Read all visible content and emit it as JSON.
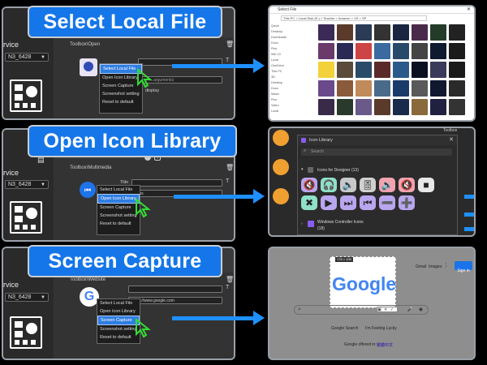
{
  "banners": [
    "Select Local File",
    "Open Icon Library",
    "Screen Capture"
  ],
  "sidebar": {
    "label": "rvice",
    "combo_value": "N3_6428"
  },
  "panel1": {
    "section": "Toolbox\\Open",
    "field_hint": "...arguments)"
  },
  "panel2": {
    "section": "Toolbox\\Multimedia",
    "title_label": "Title",
    "combo_value": "vious"
  },
  "panel3": {
    "section": "Toolbox\\Website",
    "url": "https://www.google.com"
  },
  "menu_items": [
    "Select Local File",
    "Open Icon Library",
    "Screen Capture",
    "Screenshot setting",
    "Reset to default"
  ],
  "menu_partial_label": "display",
  "explorer": {
    "title": "Select File",
    "path": "This PC > Local Disk (E:) > Teacher > Amazon > VS > SP",
    "sidebar_items": [
      "Quick",
      "Desktop",
      "Downloads",
      "Docs",
      "Pics",
      "Win 10",
      "Local",
      "OneDrive",
      "This PC",
      "3D",
      "Desktop",
      "Docs",
      "Music",
      "Pics",
      "Video",
      "Local"
    ]
  },
  "icon_library": {
    "title": "Icon Library",
    "search_placeholder": "Search",
    "group1": "Icons for Designer (13)",
    "group2": "Windows Controller Icons",
    "group2_count": "(18)",
    "app_label": "Toolbox"
  },
  "capture": {
    "logo": "Google",
    "size_badge": "178 × 100",
    "links": [
      "Gmail",
      "Images"
    ],
    "signin": "Sign in",
    "btn_search": "Google Search",
    "btn_lucky": "I'm Feeling Lucky",
    "offered": "Google offered in:",
    "offered_lang": "繁體中文"
  },
  "colors": {
    "banner": "#1476e8",
    "arrow": "#1e90ff",
    "selection": "#2f7de1"
  }
}
